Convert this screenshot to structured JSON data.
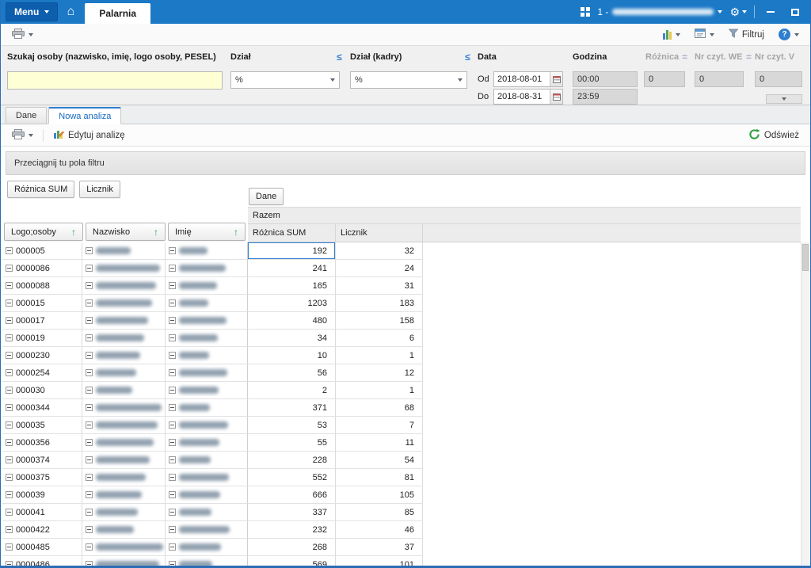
{
  "icons": {
    "home": "⌂",
    "gear": "⚙",
    "help": "?",
    "sort_asc": "↑"
  },
  "titlebar": {
    "menu_label": "Menu",
    "active_tab": "Palarnia",
    "company_prefix": "1 -"
  },
  "toolbar": {
    "filter_label": "Filtruj"
  },
  "filters": {
    "search_label": "Szukaj osoby (nazwisko, imię, logo osoby, PESEL)",
    "search_value": "",
    "dzial_label": "Dział",
    "dzial_operator": "≤",
    "dzial_value": "%",
    "dzial_kadry_label": "Dział (kadry)",
    "dzial_kadry_operator": "≤",
    "dzial_kadry_value": "%",
    "data_label": "Data",
    "od_label": "Od",
    "od_value": "2018-08-01",
    "do_label": "Do",
    "do_value": "2018-08-31",
    "godzina_label": "Godzina",
    "godzina_od_value": "00:00",
    "godzina_do_value": "23:59",
    "roznica_label": "Różnica",
    "roznica_operator": "=",
    "roznica_value": "0",
    "nr_czyt_we_label": "Nr czyt. WE",
    "nr_czyt_we_operator": "=",
    "nr_czyt_we_value": "0",
    "nr_czyt_wy_label": "Nr czyt. V",
    "nr_czyt_wy_value": "0"
  },
  "tabs": {
    "dane": "Dane",
    "nowa_analiza": "Nowa analiza"
  },
  "analysis_toolbar": {
    "edit_label": "Edytuj analizę",
    "refresh_label": "Odśwież"
  },
  "pivot": {
    "filter_area_label": "Przeciągnij tu pola filtru",
    "data_fields": [
      "Różnica SUM",
      "Licznik"
    ],
    "column_field_label": "Dane",
    "total_label": "Razem",
    "row_fields": [
      "Logo;osoby",
      "Nazwisko",
      "Imię"
    ],
    "rows": [
      {
        "logo": "000005",
        "roznica_sum": "192",
        "licznik": "32"
      },
      {
        "logo": "0000086",
        "roznica_sum": "241",
        "licznik": "24"
      },
      {
        "logo": "0000088",
        "roznica_sum": "165",
        "licznik": "31"
      },
      {
        "logo": "000015",
        "roznica_sum": "1203",
        "licznik": "183"
      },
      {
        "logo": "000017",
        "roznica_sum": "480",
        "licznik": "158"
      },
      {
        "logo": "000019",
        "roznica_sum": "34",
        "licznik": "6"
      },
      {
        "logo": "0000230",
        "roznica_sum": "10",
        "licznik": "1"
      },
      {
        "logo": "0000254",
        "roznica_sum": "56",
        "licznik": "12"
      },
      {
        "logo": "000030",
        "roznica_sum": "2",
        "licznik": "1"
      },
      {
        "logo": "0000344",
        "roznica_sum": "371",
        "licznik": "68"
      },
      {
        "logo": "000035",
        "roznica_sum": "53",
        "licznik": "7"
      },
      {
        "logo": "0000356",
        "roznica_sum": "55",
        "licznik": "11"
      },
      {
        "logo": "0000374",
        "roznica_sum": "228",
        "licznik": "54"
      },
      {
        "logo": "0000375",
        "roznica_sum": "552",
        "licznik": "81"
      },
      {
        "logo": "000039",
        "roznica_sum": "666",
        "licznik": "105"
      },
      {
        "logo": "000041",
        "roznica_sum": "337",
        "licznik": "85"
      },
      {
        "logo": "0000422",
        "roznica_sum": "232",
        "licznik": "46"
      },
      {
        "logo": "0000485",
        "roznica_sum": "268",
        "licznik": "37"
      },
      {
        "logo": "0000486",
        "roznica_sum": "569",
        "licznik": "101"
      }
    ]
  }
}
